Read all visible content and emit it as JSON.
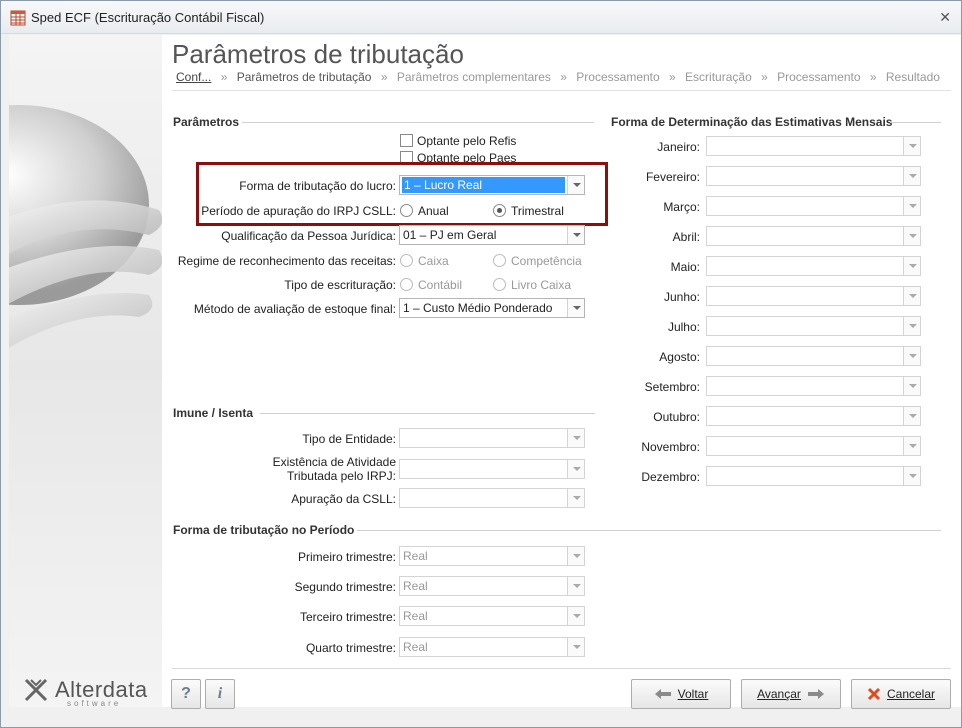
{
  "window": {
    "title": "Sped ECF (Escrituração Contábil Fiscal)",
    "close_glyph": "✕"
  },
  "page": {
    "title": "Parâmetros de tributação"
  },
  "breadcrumb": [
    {
      "label": "Conf...",
      "state": "link"
    },
    {
      "label": "Parâmetros de tributação",
      "state": "active"
    },
    {
      "label": "Parâmetros complementares",
      "state": "inactive"
    },
    {
      "label": "Processamento",
      "state": "inactive"
    },
    {
      "label": "Escrituração",
      "state": "inactive"
    },
    {
      "label": "Processamento",
      "state": "inactive"
    },
    {
      "label": "Resultado",
      "state": "inactive"
    }
  ],
  "breadcrumb_sep": "»",
  "parametros": {
    "title": "Parâmetros",
    "optante_refis": "Optante pelo Refis",
    "optante_paes": "Optante pelo Paes",
    "forma_tributacao_label": "Forma de tributação do lucro:",
    "forma_tributacao_value": "1 – Lucro Real",
    "periodo_label": "Período de apuração do IRPJ CSLL:",
    "periodo_anual": "Anual",
    "periodo_trimestral": "Trimestral",
    "qualificacao_label": "Qualificação da Pessoa Jurídica:",
    "qualificacao_value": "01 – PJ em Geral",
    "regime_label": "Regime de reconhecimento das receitas:",
    "regime_caixa": "Caixa",
    "regime_competencia": "Competência",
    "tipo_escrituracao_label": "Tipo de escrituração:",
    "tipo_contabil": "Contábil",
    "tipo_livro_caixa": "Livro Caixa",
    "metodo_label": "Método de avaliação de estoque final:",
    "metodo_value": "1 – Custo Médio Ponderado"
  },
  "imune": {
    "title": "Imune / Isenta",
    "tipo_entidade_label": "Tipo de Entidade:",
    "existencia_label_1": "Existência de Atividade",
    "existencia_label_2": "Tributada pelo IRPJ:",
    "apuracao_csll_label": "Apuração da CSLL:"
  },
  "periodo": {
    "title": "Forma de tributação no Período",
    "rows": [
      {
        "label": "Primeiro trimestre:",
        "value": "Real"
      },
      {
        "label": "Segundo trimestre:",
        "value": "Real"
      },
      {
        "label": "Terceiro trimestre:",
        "value": "Real"
      },
      {
        "label": "Quarto trimestre:",
        "value": "Real"
      }
    ]
  },
  "estimativas": {
    "title": "Forma de Determinação das Estimativas Mensais",
    "months": [
      "Janeiro:",
      "Fevereiro:",
      "Março:",
      "Abril:",
      "Maio:",
      "Junho:",
      "Julho:",
      "Agosto:",
      "Setembro:",
      "Outubro:",
      "Novembro:",
      "Dezembro:"
    ]
  },
  "buttons": {
    "help": "?",
    "info": "i",
    "voltar": "Voltar",
    "avancar": "Avançar",
    "cancelar": "Cancelar"
  },
  "brand": {
    "name": "Alterdata",
    "sub": "software"
  },
  "colors": {
    "highlight": "#8b0f0f",
    "selection": "#3399ff",
    "cancel_icon": "#e04a1c",
    "arrow_icon": "#8a8a8a"
  }
}
